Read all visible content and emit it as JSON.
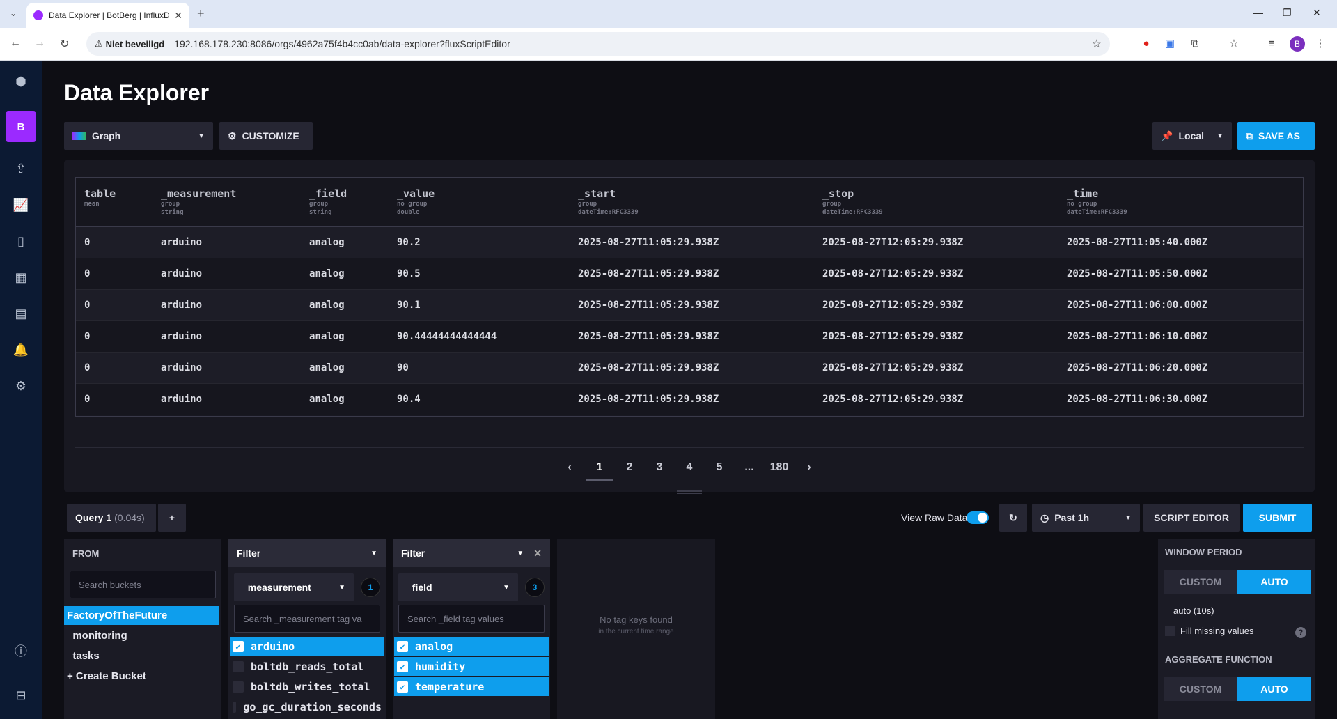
{
  "browser": {
    "tab_title": "Data Explorer | BotBerg | InfluxD",
    "new_tab": "+",
    "security_label": "Niet beveiligd",
    "url": "192.168.178.230:8086/orgs/4962a75f4b4cc0ab/data-explorer?fluxScriptEditor",
    "profile_initial": "B"
  },
  "nav": {
    "org_initial": "B",
    "items": [
      "logo-icon",
      "upload-icon",
      "graph-icon",
      "notebook-icon",
      "dashboard-icon",
      "calendar-icon",
      "bell-icon",
      "gear-icon",
      "help-icon",
      "collapse-icon"
    ]
  },
  "header": {
    "title": "Data Explorer",
    "vis_type": "Graph",
    "customize": "CUSTOMIZE",
    "timezone": "Local",
    "save_as": "SAVE AS"
  },
  "table": {
    "columns": [
      {
        "name": "table",
        "meta1": "mean",
        "meta2": ""
      },
      {
        "name": "_measurement",
        "meta1": "group",
        "meta2": "string"
      },
      {
        "name": "_field",
        "meta1": "group",
        "meta2": "string"
      },
      {
        "name": "_value",
        "meta1": "no group",
        "meta2": "double"
      },
      {
        "name": "_start",
        "meta1": "group",
        "meta2": "dateTime:RFC3339"
      },
      {
        "name": "_stop",
        "meta1": "group",
        "meta2": "dateTime:RFC3339"
      },
      {
        "name": "_time",
        "meta1": "no group",
        "meta2": "dateTime:RFC3339"
      }
    ],
    "rows": [
      [
        "0",
        "arduino",
        "analog",
        "90.2",
        "2025-08-27T11:05:29.938Z",
        "2025-08-27T12:05:29.938Z",
        "2025-08-27T11:05:40.000Z"
      ],
      [
        "0",
        "arduino",
        "analog",
        "90.5",
        "2025-08-27T11:05:29.938Z",
        "2025-08-27T12:05:29.938Z",
        "2025-08-27T11:05:50.000Z"
      ],
      [
        "0",
        "arduino",
        "analog",
        "90.1",
        "2025-08-27T11:05:29.938Z",
        "2025-08-27T12:05:29.938Z",
        "2025-08-27T11:06:00.000Z"
      ],
      [
        "0",
        "arduino",
        "analog",
        "90.44444444444444",
        "2025-08-27T11:05:29.938Z",
        "2025-08-27T12:05:29.938Z",
        "2025-08-27T11:06:10.000Z"
      ],
      [
        "0",
        "arduino",
        "analog",
        "90",
        "2025-08-27T11:05:29.938Z",
        "2025-08-27T12:05:29.938Z",
        "2025-08-27T11:06:20.000Z"
      ],
      [
        "0",
        "arduino",
        "analog",
        "90.4",
        "2025-08-27T11:05:29.938Z",
        "2025-08-27T12:05:29.938Z",
        "2025-08-27T11:06:30.000Z"
      ]
    ]
  },
  "pager": {
    "prev": "‹",
    "pages": [
      "1",
      "2",
      "3",
      "4",
      "5",
      "...",
      "180"
    ],
    "current": "1",
    "next": "›"
  },
  "query": {
    "tab_name": "Query 1",
    "tab_time": "(0.04s)",
    "add": "+",
    "view_raw": "View Raw Data",
    "view_raw_on": true,
    "time_range": "Past 1h",
    "script_editor": "SCRIPT EDITOR",
    "submit": "SUBMIT"
  },
  "from": {
    "header": "FROM",
    "search_placeholder": "Search buckets",
    "buckets": [
      "FactoryOfTheFuture",
      "_monitoring",
      "_tasks",
      "+ Create Bucket"
    ],
    "selected": "FactoryOfTheFuture"
  },
  "filter1": {
    "header": "Filter",
    "key": "_measurement",
    "count": "1",
    "search_placeholder": "Search _measurement tag va",
    "items": [
      {
        "label": "arduino",
        "checked": true
      },
      {
        "label": "boltdb_reads_total",
        "checked": false
      },
      {
        "label": "boltdb_writes_total",
        "checked": false
      },
      {
        "label": "go_gc_duration_seconds",
        "checked": false
      }
    ]
  },
  "filter2": {
    "header": "Filter",
    "key": "_field",
    "count": "3",
    "search_placeholder": "Search _field tag values",
    "items": [
      {
        "label": "analog",
        "checked": true
      },
      {
        "label": "humidity",
        "checked": true
      },
      {
        "label": "temperature",
        "checked": true
      }
    ]
  },
  "empty_card": {
    "title": "No tag keys found",
    "subtitle": "in the current time range"
  },
  "window": {
    "period_label": "WINDOW PERIOD",
    "custom": "CUSTOM",
    "auto": "AUTO",
    "auto_value": "auto (10s)",
    "fill_missing": "Fill missing values",
    "help": "?",
    "aggregate_label": "AGGREGATE FUNCTION"
  },
  "colors": {
    "accent": "#0e9eed",
    "org": "#9b2aff",
    "nav_bg": "#0c1a33"
  }
}
